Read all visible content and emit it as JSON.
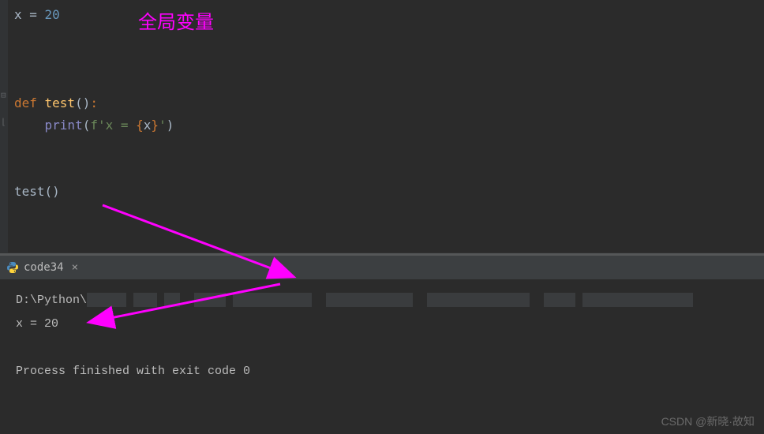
{
  "editor": {
    "line1_var": "x ",
    "line1_eq": "= ",
    "line1_val": "20",
    "line4_def": "def ",
    "line4_fn": "test",
    "line4_paren": "()",
    "line4_colon": ":",
    "line5_indent": "    ",
    "line5_print": "print",
    "line5_open": "(",
    "line5_fstr_prefix": "f'x = ",
    "line5_brace_open": "{",
    "line5_var": "x",
    "line5_brace_close": "}",
    "line5_fstr_close": "'",
    "line5_close": ")",
    "line8_call": "test()"
  },
  "annotation": {
    "label": "全局变量"
  },
  "tab": {
    "name": "code34",
    "close": "×"
  },
  "console": {
    "path": "D:\\Python\\",
    "output": "x = 20",
    "exit": "Process finished with exit code 0"
  },
  "watermark": "CSDN @新晓·故知"
}
